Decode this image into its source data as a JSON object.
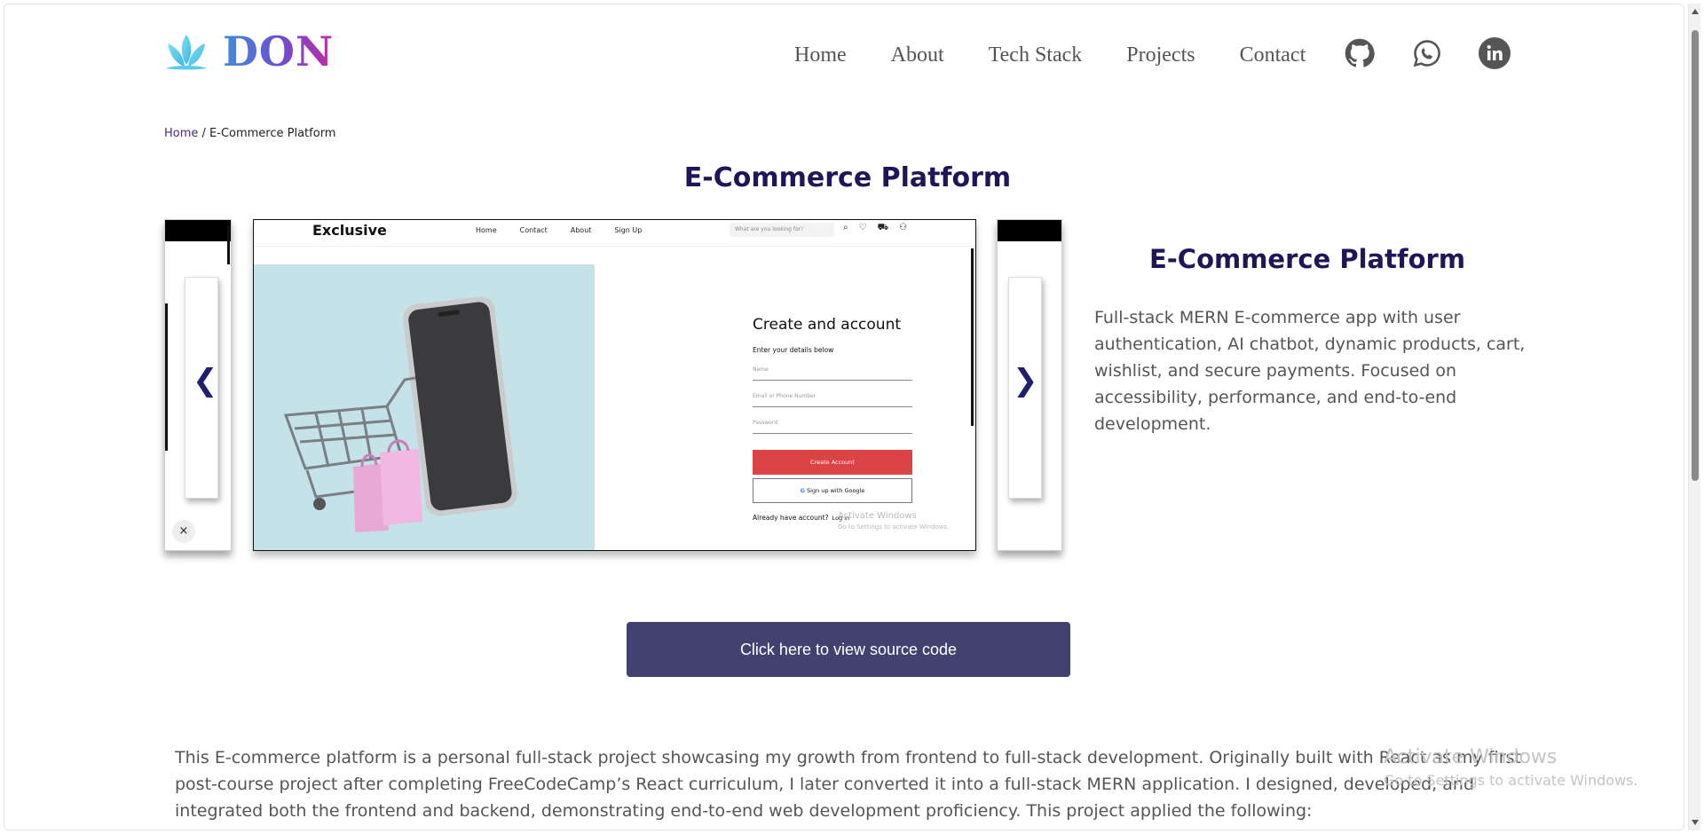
{
  "brand": {
    "name": "DON"
  },
  "nav": {
    "links": [
      "Home",
      "About",
      "Tech Stack",
      "Projects",
      "Contact"
    ],
    "socials": [
      "github-icon",
      "whatsapp-icon",
      "linkedin-icon"
    ]
  },
  "breadcrumb": {
    "home": "Home",
    "separator": " / ",
    "current": "E-Commerce Platform"
  },
  "page": {
    "title": "E-Commerce Platform"
  },
  "carousel": {
    "prev": "❮",
    "next": "❯",
    "close": "×",
    "slide": {
      "brand": "Exclusive",
      "nav": [
        "Home",
        "Contact",
        "About",
        "Sign Up"
      ],
      "search_placeholder": "What are you looking for?",
      "form_title": "Create and account",
      "form_subtitle": "Enter your details below",
      "field_name": "Name",
      "field_email": "Email or Phone Number",
      "field_password": "Password",
      "create_button": "Create Account",
      "google_button": "Sign up with Google",
      "login_prompt": "Already have account?",
      "login_link": "Log in",
      "watermark_title": "Activate Windows",
      "watermark_sub": "Go to Settings to activate Windows."
    }
  },
  "project": {
    "title": "E-Commerce Platform",
    "description": "Full-stack MERN E-commerce app with user authentication, AI chatbot, dynamic products, cart, wishlist, and secure payments. Focused on accessibility, performance, and end-to-end development."
  },
  "source_button": "Click here to view source code",
  "body_text": "This E-commerce platform is a personal full-stack project showcasing my growth from frontend to full-stack development. Originally built with React as my first post-course project after completing FreeCodeCamp’s React curriculum, I later converted it into a full-stack MERN application. I designed, developed, and integrated both the frontend and backend, demonstrating end-to-end web development proficiency. This project applied the following:",
  "watermark": {
    "title": "Activate Windows",
    "subtitle": "Go to Settings to activate Windows."
  },
  "colors": {
    "title": "#1f1657",
    "button": "#424271",
    "accent_red": "#db4444",
    "link": "#4a2a7a"
  }
}
